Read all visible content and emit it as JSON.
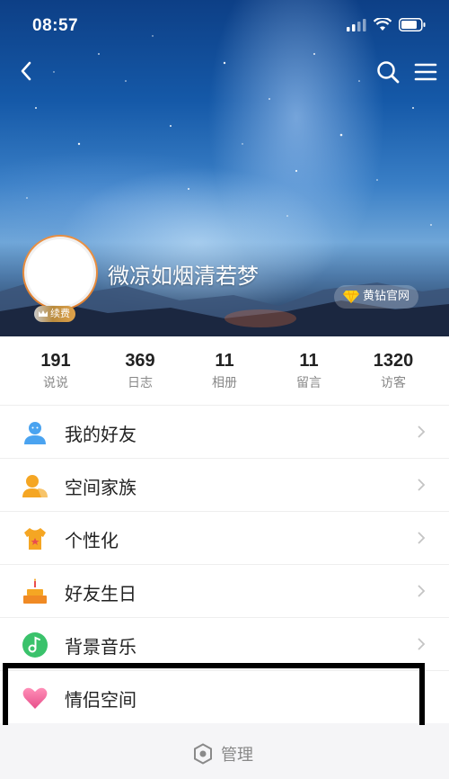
{
  "status_bar": {
    "time": "08:57",
    "icons": [
      "signal-icon",
      "wifi-icon",
      "battery-icon"
    ]
  },
  "header": {
    "back_icon": "back-icon",
    "search_icon": "search-icon",
    "menu_icon": "menu-icon",
    "nickname": "微凉如烟清若梦",
    "renew_label": "续费",
    "yellow_diamond_label": "黄钻官网"
  },
  "stats": [
    {
      "value": "191",
      "label": "说说"
    },
    {
      "value": "369",
      "label": "日志"
    },
    {
      "value": "11",
      "label": "相册"
    },
    {
      "value": "11",
      "label": "留言"
    },
    {
      "value": "1320",
      "label": "访客"
    }
  ],
  "menu": [
    {
      "label": "我的好友",
      "icon": "friends-icon"
    },
    {
      "label": "空间家族",
      "icon": "family-icon"
    },
    {
      "label": "个性化",
      "icon": "personalize-icon"
    },
    {
      "label": "好友生日",
      "icon": "birthday-cake-icon"
    },
    {
      "label": "背景音乐",
      "icon": "music-icon"
    },
    {
      "label": "情侣空间",
      "icon": "heart-icon"
    }
  ],
  "footer": {
    "manage_label": "管理",
    "manage_icon": "hexagon-settings-icon"
  },
  "colors": {
    "accent_blue": "#4aa3f0",
    "orange": "#f5a623",
    "green": "#3ac26b",
    "pink": "#f06292",
    "highlight_border": "#000000"
  }
}
